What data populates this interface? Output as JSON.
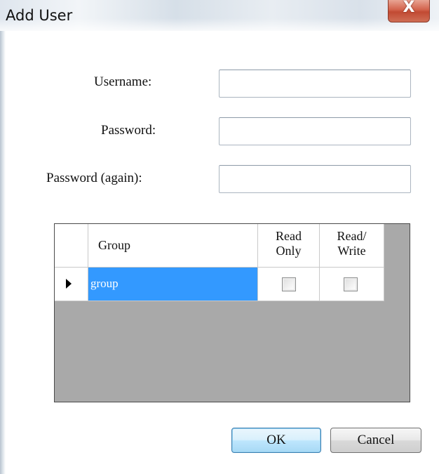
{
  "window": {
    "title": "Add User",
    "close_glyph": "X"
  },
  "form": {
    "username_label": "Username:",
    "username_value": "",
    "password_label": "Password:",
    "password_value": "",
    "password_again_label": "Password (again):",
    "password_again_value": ""
  },
  "grid": {
    "columns": [
      "Group",
      "Read Only",
      "Read/ Write"
    ],
    "column_lines": {
      "read_only": [
        "Read",
        "Only"
      ],
      "read_write": [
        "Read/",
        "Write"
      ]
    },
    "rows": [
      {
        "group": "group",
        "read_only": false,
        "read_write": false,
        "selected": true
      }
    ],
    "selection_color": "#3399ff"
  },
  "buttons": {
    "ok_label": "OK",
    "cancel_label": "Cancel"
  }
}
